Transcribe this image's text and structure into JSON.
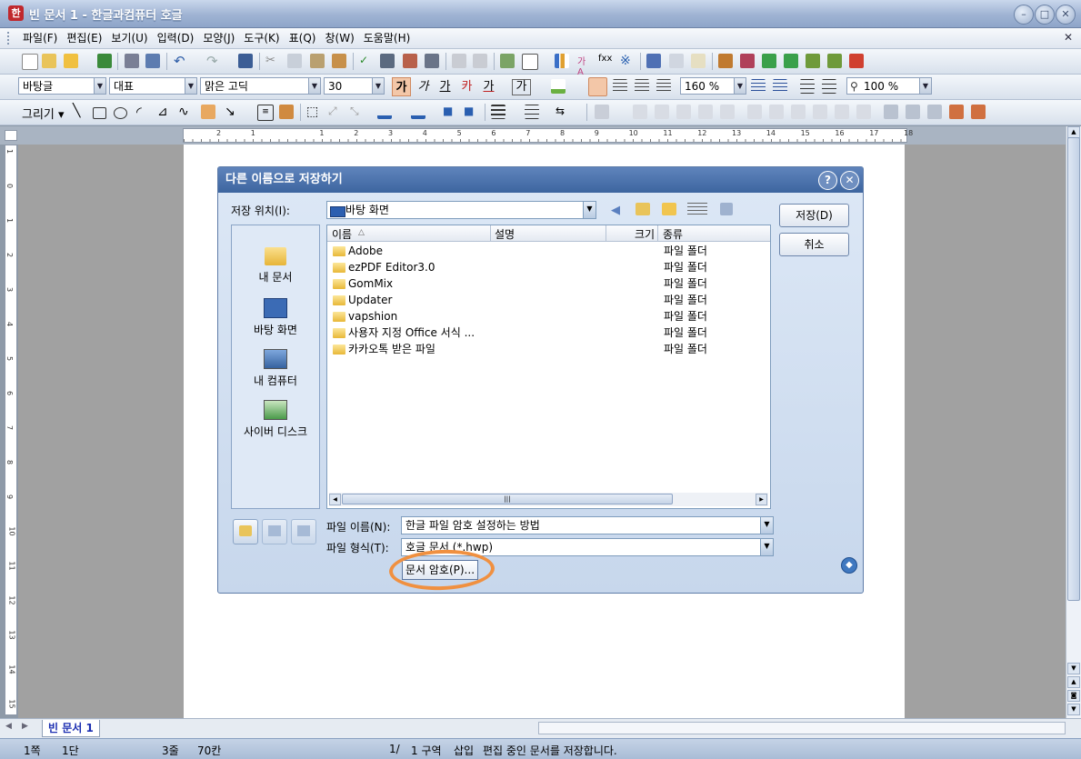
{
  "window": {
    "title": "빈 문서 1 - 한글과컴퓨터 호글",
    "app_icon": "hangul-app-icon"
  },
  "menu": [
    "파일(F)",
    "편집(E)",
    "보기(U)",
    "입력(D)",
    "모양(J)",
    "도구(K)",
    "표(Q)",
    "창(W)",
    "도움말(H)"
  ],
  "format": {
    "style": "바탕글",
    "font_lang": "대표",
    "font": "맑은 고딕",
    "size": "30",
    "line_spacing": "160 %",
    "zoom": "100 %",
    "bold": "가",
    "italic": "가",
    "underline": "가",
    "strike": "카",
    "color_text": "가",
    "shade_text": "가"
  },
  "drawing": {
    "label": "그리기"
  },
  "ruler": {
    "h_labels": [
      "2",
      "1",
      "",
      "1",
      "2",
      "3",
      "4",
      "5",
      "6",
      "7",
      "8",
      "9",
      "10",
      "11",
      "12",
      "13",
      "14",
      "15",
      "16",
      "17",
      "18"
    ],
    "v_labels": [
      "1",
      "0",
      "1",
      "2",
      "3",
      "4",
      "5",
      "6",
      "7",
      "8",
      "9",
      "10",
      "11",
      "12",
      "13",
      "14",
      "15"
    ]
  },
  "dialog": {
    "title": "다른 이름으로 저장하기",
    "location_label": "저장 위치(I):",
    "location_value": "바탕 화면",
    "places": [
      "내 문서",
      "바탕 화면",
      "내 컴퓨터",
      "사이버 디스크"
    ],
    "columns": [
      "이름",
      "설명",
      "크기",
      "종류"
    ],
    "files": [
      {
        "name": "Adobe",
        "type": "파일 폴더"
      },
      {
        "name": "ezPDF Editor3.0",
        "type": "파일 폴더"
      },
      {
        "name": "GomMix",
        "type": "파일 폴더"
      },
      {
        "name": "Updater",
        "type": "파일 폴더"
      },
      {
        "name": "vapshion",
        "type": "파일 폴더"
      },
      {
        "name": "사용자 지정 Office 서식 ...",
        "type": "파일 폴더"
      },
      {
        "name": "카카오톡 받은 파일",
        "type": "파일 폴더"
      }
    ],
    "filename_label": "파일 이름(N):",
    "filename_value": "한글 파일 암호 설정하는 방법",
    "filetype_label": "파일 형식(T):",
    "filetype_value": "호글 문서 (*.hwp)",
    "save_button": "저장(D)",
    "cancel_button": "취소",
    "password_button": "문서 암호(P)..."
  },
  "tabs": {
    "doc_tab": "빈 문서 1"
  },
  "status": {
    "page": "1쪽",
    "column": "1단",
    "line": "3줄",
    "col": "70칸",
    "page_of": "1/",
    "section": "1 구역",
    "insert": "삽입",
    "message": "편집 중인 문서를 저장합니다."
  },
  "colors": {
    "highlight": "#f09040",
    "dialog_title": "#3d659f"
  }
}
